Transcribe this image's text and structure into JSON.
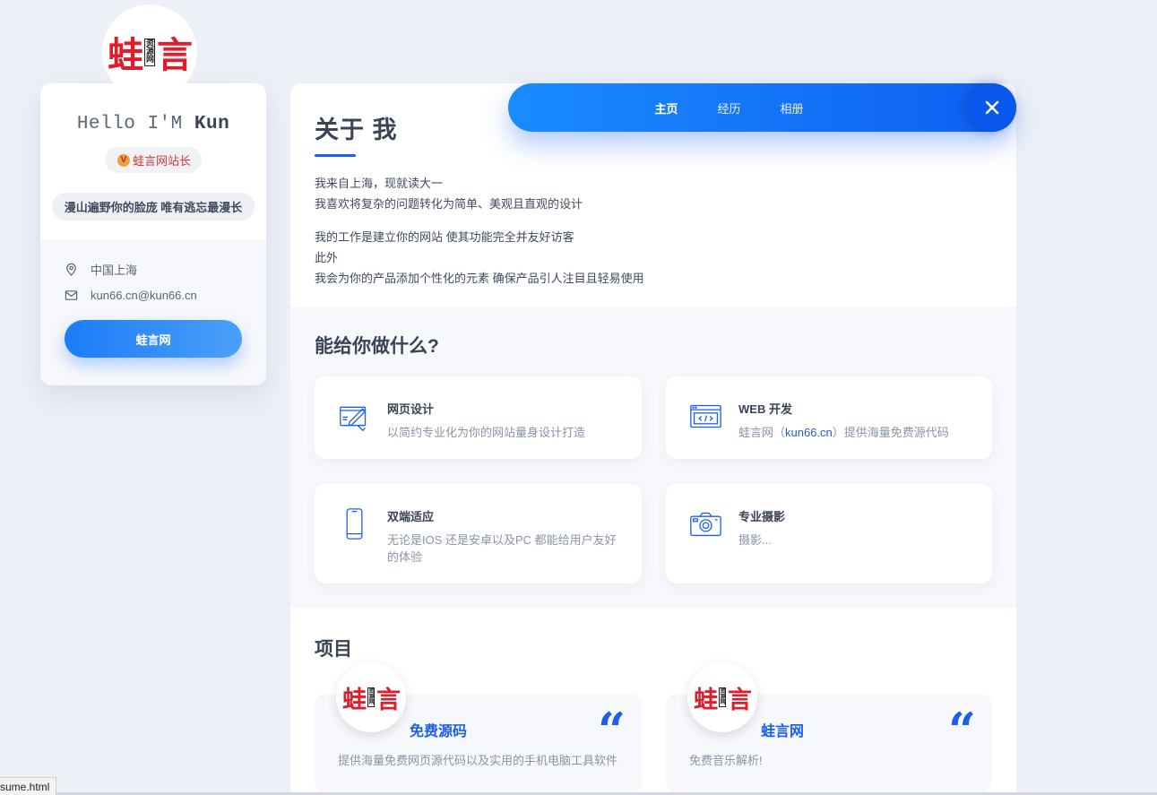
{
  "logo": {
    "big": "蛙",
    "big2": "言",
    "mini": [
      "资",
      "源",
      "网"
    ]
  },
  "profile": {
    "greeting_prefix": "Hello I'M ",
    "greeting_name": "Kun",
    "badge_icon": "V",
    "badge_text": "蛙言网站长",
    "motto": "漫山遍野你的脸庞 唯有逃忘最漫长",
    "location": "中国上海",
    "email": "kun66.cn@kun66.cn",
    "button_label": "蛙言网"
  },
  "nav": {
    "items": [
      {
        "label": "主页",
        "active": true
      },
      {
        "label": "经历",
        "active": false
      },
      {
        "label": "相册",
        "active": false
      }
    ],
    "close_icon": "close-icon"
  },
  "about": {
    "title": "关于 我",
    "para1": [
      "我来自上海，现就读大一",
      "我喜欢将复杂的问题转化为简单、美观且直观的设计"
    ],
    "para2": [
      "我的工作是建立你的网站 使其功能完全并友好访客",
      "此外",
      "我会为你的产品添加个性化的元素 确保产品引人注目且轻易使用"
    ]
  },
  "services": {
    "title": "能给你做什么?",
    "items": [
      {
        "name": "网页设计",
        "desc": "以简约专业化为你的网站量身设计打造",
        "icon": "design-icon"
      },
      {
        "name": "WEB 开发",
        "desc_pre": "蛙言网（",
        "desc_link": "kun66.cn",
        "desc_post": "）提供海量免费源代码",
        "icon": "code-window-icon"
      },
      {
        "name": "双端适应",
        "desc": "无论是IOS 还是安卓以及PC 都能给用户友好的体验",
        "icon": "phone-icon"
      },
      {
        "name": "专业摄影",
        "desc": "摄影...",
        "icon": "camera-icon"
      }
    ]
  },
  "projects": {
    "title": "项目",
    "items": [
      {
        "name": "免费源码",
        "desc": "提供海量免费网页源代码以及实用的手机电脑工具软件",
        "quote": "“"
      },
      {
        "name": "蛙言网",
        "desc": "免费音乐解析!",
        "quote": "“"
      }
    ]
  },
  "status_bar": {
    "text": "sume.html"
  },
  "colors": {
    "accent": "#1c5ef0",
    "nav_start": "#1a8bff",
    "nav_end": "#0e5ff2",
    "brand_red": "#e11d2b"
  }
}
